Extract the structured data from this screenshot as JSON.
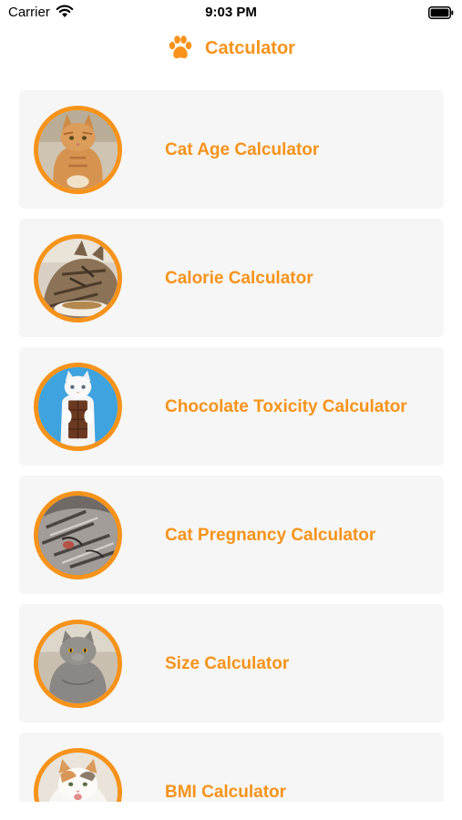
{
  "status_bar": {
    "carrier": "Carrier",
    "time": "9:03 PM",
    "wifi_icon": "wifi-icon",
    "battery_icon": "battery-icon"
  },
  "nav": {
    "title": "Catculator",
    "icon": "paw-icon",
    "accent_color": "#f7931a"
  },
  "calculators": [
    {
      "label": "Cat Age Calculator",
      "image": "orange tabby cat"
    },
    {
      "label": "Calorie Calculator",
      "image": "tabby cat eating"
    },
    {
      "label": "Chocolate Toxicity Calculator",
      "image": "white cat holding chocolate bar"
    },
    {
      "label": "Cat Pregnancy Calculator",
      "image": "sleeping gray cat"
    },
    {
      "label": "Size Calculator",
      "image": "gray british shorthair cat"
    },
    {
      "label": "BMI Calculator",
      "image": "white and orange cat"
    }
  ]
}
